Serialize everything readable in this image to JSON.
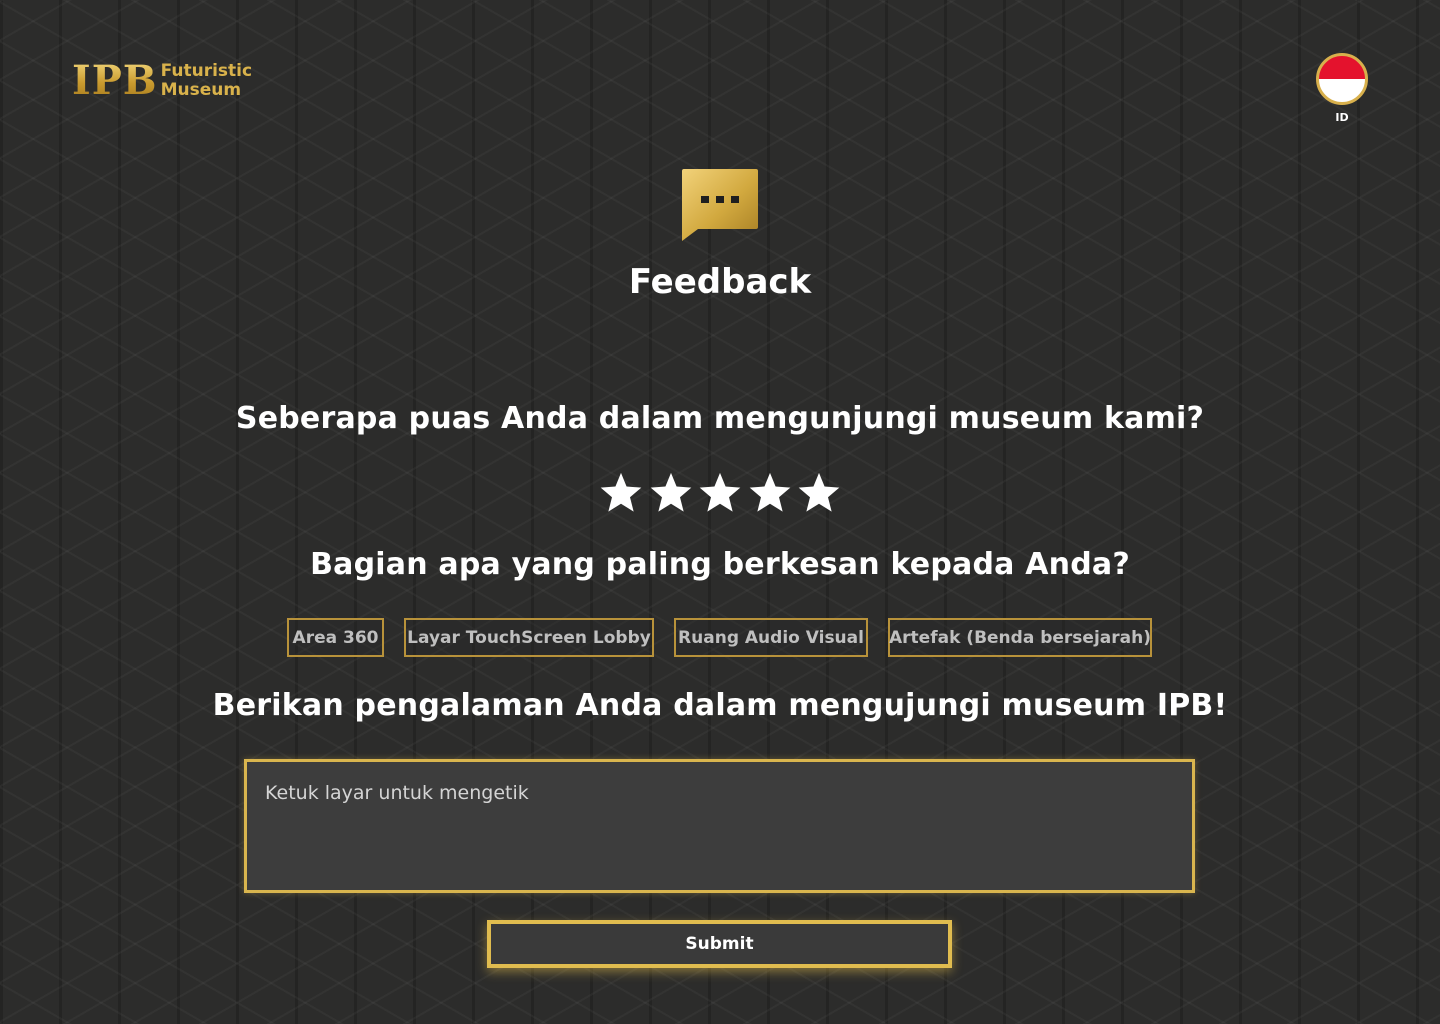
{
  "logo": {
    "mark": "IPB",
    "line1": "Futuristic",
    "line2": "Museum"
  },
  "language": {
    "code": "ID",
    "flag_icon": "indonesia-flag-icon"
  },
  "header": {
    "icon": "chat-bubble-icon",
    "title": "Feedback"
  },
  "rating": {
    "question": "Seberapa puas Anda dalam mengunjungi museum kami?",
    "max": 5,
    "value": 5,
    "icon": "star-icon"
  },
  "sections": {
    "question": "Bagian apa yang paling berkesan kepada Anda?",
    "options": [
      "Area 360",
      "Layar TouchScreen Lobby",
      "Ruang Audio Visual",
      "Artefak (Benda bersejarah)"
    ]
  },
  "experience": {
    "question": "Berikan pengalaman Anda dalam mengujungi museum IPB!",
    "placeholder": "Ketuk layar untuk mengetik"
  },
  "submit_label": "Submit",
  "colors": {
    "background": "#2c2c2b",
    "gold": "#d9b54e",
    "text": "#ffffff"
  }
}
